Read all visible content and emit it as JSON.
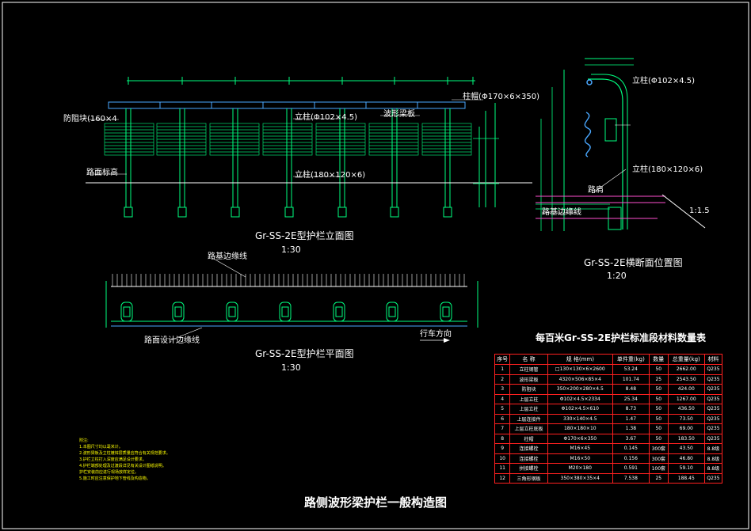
{
  "drawing": {
    "title": "路侧波形梁护栏一般构造图",
    "elevation": {
      "title": "Gr-SS-2E型护栏立面图",
      "scale": "1:30",
      "labels": {
        "anti_block": "防阻块(160×4",
        "beam_plate": "波形梁板",
        "cap": "柱帽(Φ170×6×350)",
        "post_upper": "立柱(Φ102×4.5)",
        "post_lower": "立柱(180×120×6)",
        "ground": "路面标高"
      }
    },
    "plan": {
      "title": "Gr-SS-2E型护栏平面图",
      "scale": "1:30",
      "labels": {
        "top": "路基边缘线",
        "bottom": "路面设计边缘线",
        "direction": "行车方向"
      }
    },
    "section": {
      "title": "Gr-SS-2E横断面位置图",
      "scale": "1:20",
      "labels": {
        "post_upper": "立柱(Φ102×4.5)",
        "post_lower": "立柱(180×120×6)",
        "shoulder": "路肩",
        "edge": "路基边缘线",
        "slope": "1:1.5"
      }
    },
    "notes": {
      "heading": "附注:",
      "items": [
        "1.本图尺寸均以毫米计。",
        "2.波形梁板及立柱镀锌层质量应符合有关规范要求。",
        "3.护栏立柱打入深度应满足设计要求。",
        "4.护栏端部处理及过渡段详见有关设计图纸说明。",
        "  护栏安装前应进行现场放样定位。",
        "5.施工时应注意保护地下管线及构造物。"
      ]
    },
    "table": {
      "title": "每百米Gr-SS-2E护栏标准段材料数量表",
      "headers": [
        "序号",
        "名  称",
        "规  格(mm)",
        "单件重(kg)",
        "数量",
        "总重量(kg)",
        "材料"
      ],
      "rows": [
        [
          "1",
          "立柱钢管",
          "□130×130×6×2600",
          "53.24",
          "50",
          "2662.00",
          "Q235"
        ],
        [
          "2",
          "波形梁板",
          "4320×506×85×4",
          "101.74",
          "25",
          "2543.50",
          "Q235"
        ],
        [
          "3",
          "防阻块",
          "350×200×280×4.5",
          "8.48",
          "50",
          "424.00",
          "Q235"
        ],
        [
          "4",
          "上层立柱",
          "Φ102×4.5×2334",
          "25.34",
          "50",
          "1267.00",
          "Q235"
        ],
        [
          "5",
          "上层立柱",
          "Φ102×4.5×610",
          "8.73",
          "50",
          "436.50",
          "Q235"
        ],
        [
          "6",
          "上层连接件",
          "330×140×4.5",
          "1.47",
          "50",
          "73.50",
          "Q235"
        ],
        [
          "7",
          "上层立柱底板",
          "180×180×10",
          "1.38",
          "50",
          "69.00",
          "Q235"
        ],
        [
          "8",
          "柱帽",
          "Φ170×6×350",
          "3.67",
          "50",
          "183.50",
          "Q235"
        ],
        [
          "9",
          "连接螺栓",
          "M16×45",
          "0.145",
          "300套",
          "43.50",
          "8.8级"
        ],
        [
          "10",
          "连接螺栓",
          "M16×50",
          "0.156",
          "300套",
          "46.80",
          "8.8级"
        ],
        [
          "11",
          "拼接螺栓",
          "M20×180",
          "0.591",
          "100套",
          "59.10",
          "8.8级"
        ],
        [
          "12",
          "三角形钢板",
          "350×380×35×4",
          "7.538",
          "25",
          "188.45",
          "Q235"
        ]
      ]
    }
  }
}
